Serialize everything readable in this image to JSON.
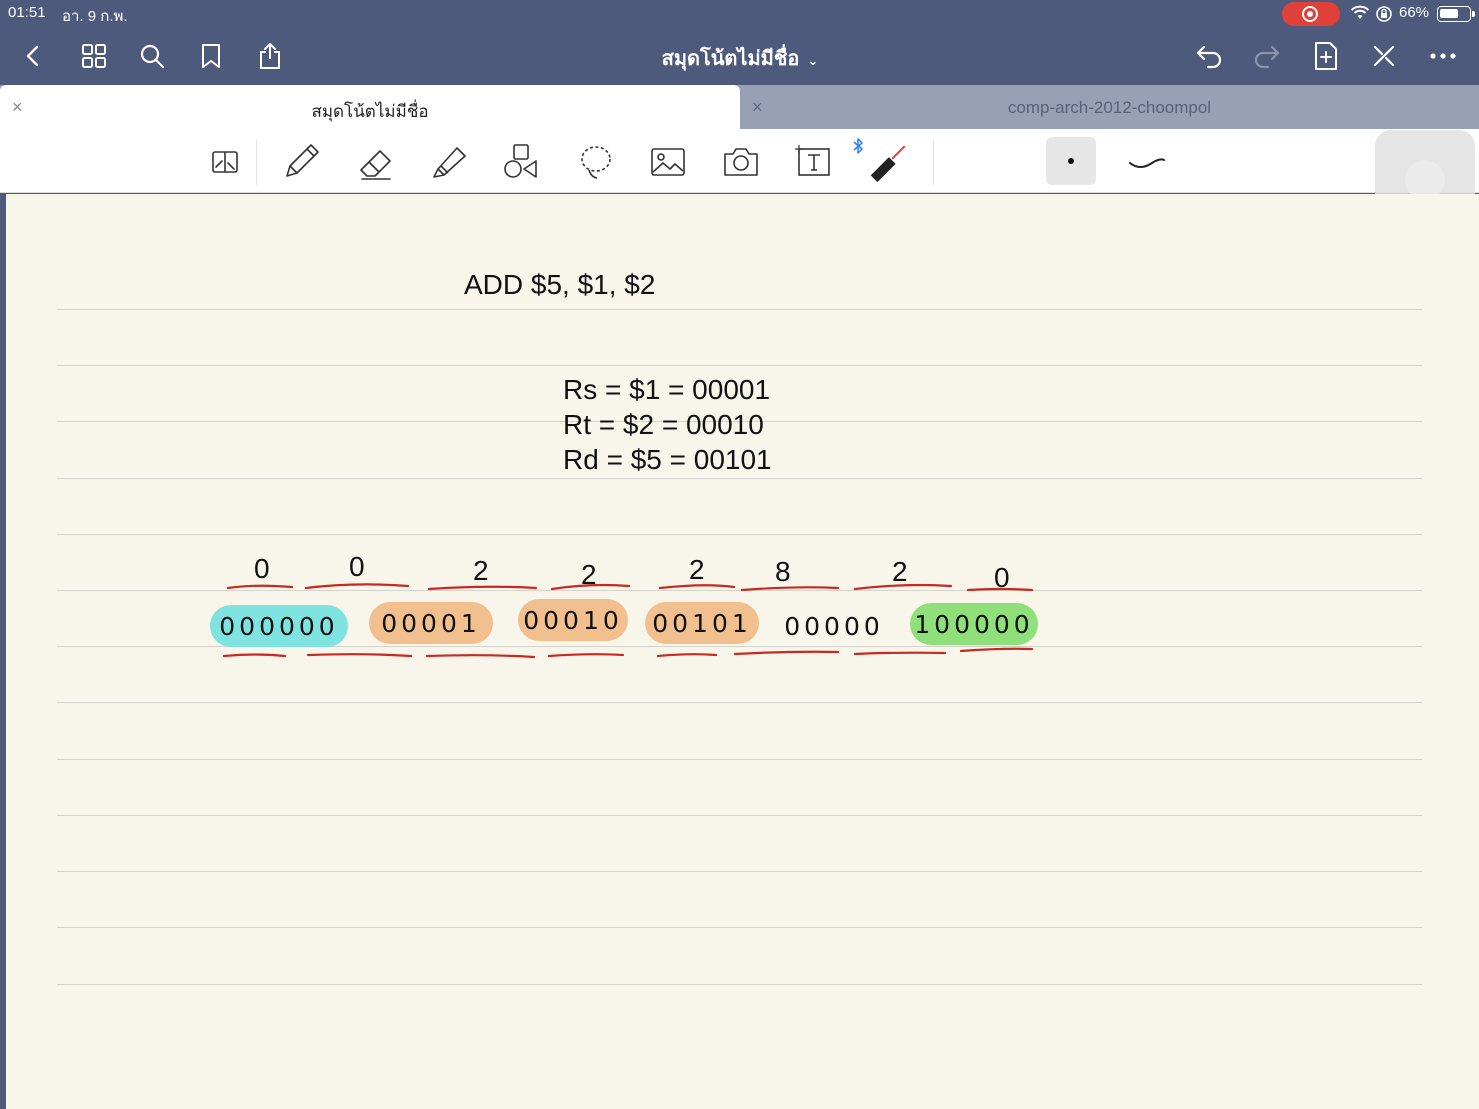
{
  "status": {
    "time": "01:51",
    "date": "อา. 9 ก.พ.",
    "battery": "66%",
    "battery_level": 0.66
  },
  "nav": {
    "title": "สมุดโน้ตไม่มีชื่อ"
  },
  "tabs": [
    {
      "label": "สมุดโน้ตไม่มีชื่อ",
      "close": "×"
    },
    {
      "label": "comp-arch-2012-choompol",
      "close": "×"
    }
  ],
  "note": {
    "instruction": "ADD $5, $1, $2",
    "registers": [
      "Rs = $1 = 00001",
      "Rt = $2 = 00010",
      "Rd = $5 = 00101"
    ],
    "hex_digits": [
      "0",
      "0",
      "2",
      "2",
      "2",
      "8",
      "2",
      "0"
    ],
    "binary_fields": [
      {
        "bits": "000000",
        "color": "#7fe3df"
      },
      {
        "bits": "00001",
        "color": "#f2c08f"
      },
      {
        "bits": "00010",
        "color": "#f2c08f"
      },
      {
        "bits": "00101",
        "color": "#f2c08f"
      },
      {
        "bits": "00000",
        "color": ""
      },
      {
        "bits": "100000",
        "color": "#8fe07a"
      }
    ]
  }
}
